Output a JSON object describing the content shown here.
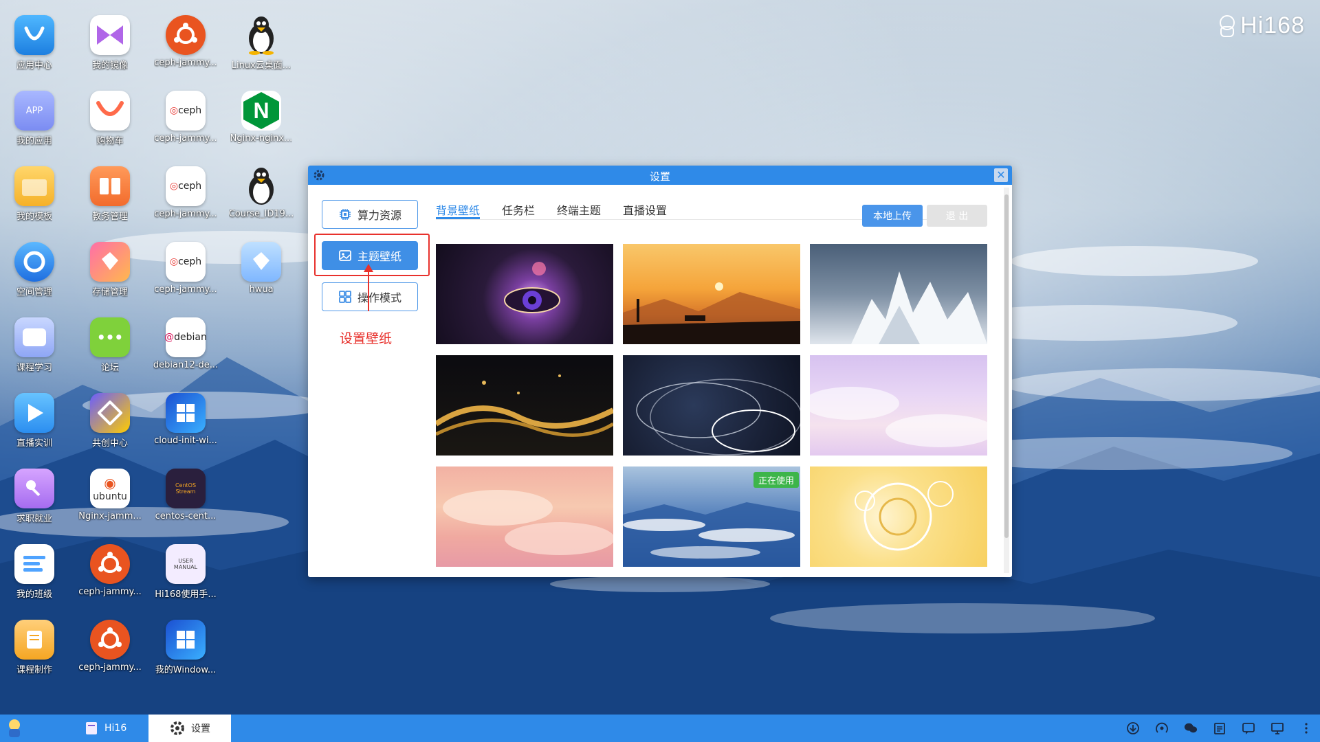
{
  "brand": "Hi168",
  "desktop_icons": [
    {
      "label": "应用中心"
    },
    {
      "label": "我的镜像"
    },
    {
      "label": "ceph-jammy..."
    },
    {
      "label": "Linux云桌面..."
    },
    {
      "label": "我的应用",
      "icon_text": "APP"
    },
    {
      "label": "购物车"
    },
    {
      "label": "ceph-jammy...",
      "icon_text": "ceph"
    },
    {
      "label": "Nginx-nginx...",
      "icon_text": "N"
    },
    {
      "label": "我的模板"
    },
    {
      "label": "教务管理"
    },
    {
      "label": "ceph-jammy...",
      "icon_text": "ceph"
    },
    {
      "label": "Course_ID19..."
    },
    {
      "label": "空间管理"
    },
    {
      "label": "存储管理"
    },
    {
      "label": "ceph-jammy...",
      "icon_text": "ceph"
    },
    {
      "label": "hwua"
    },
    {
      "label": "课程学习"
    },
    {
      "label": "论坛",
      "icon_text": "•••"
    },
    {
      "label": "debian12-de...",
      "icon_text": "debian"
    },
    {
      "label": "直播实训"
    },
    {
      "label": "共创中心"
    },
    {
      "label": "cloud-init-wi..."
    },
    {
      "label": "求职就业"
    },
    {
      "label": "Nginx-jamm...",
      "icon_text": "ubuntu"
    },
    {
      "label": "centos-cent...",
      "icon_text": "CentOS Stream"
    },
    {
      "label": "我的班级"
    },
    {
      "label": "ceph-jammy..."
    },
    {
      "label": "Hi168使用手...",
      "icon_text": "USER MANUAL"
    },
    {
      "label": "课程制作"
    },
    {
      "label": "ceph-jammy..."
    },
    {
      "label": "我的Window..."
    }
  ],
  "window": {
    "title": "设置",
    "side_buttons": [
      {
        "label": "算力资源",
        "icon": "cpu-icon"
      },
      {
        "label": "主题壁纸",
        "icon": "image-icon",
        "active": true
      },
      {
        "label": "操作模式",
        "icon": "grid-icon"
      }
    ],
    "annotation": "设置壁纸",
    "tabs": [
      {
        "label": "背景壁纸",
        "active": true
      },
      {
        "label": "任务栏"
      },
      {
        "label": "终端主题"
      },
      {
        "label": "直播设置"
      }
    ],
    "upload_label": "本地上传",
    "exit_label": "退 出",
    "wallpapers": [
      {
        "name": "galaxy-eye"
      },
      {
        "name": "desert-sunset"
      },
      {
        "name": "ice-crystals"
      },
      {
        "name": "gold-waves"
      },
      {
        "name": "light-trails"
      },
      {
        "name": "pastel-clouds"
      },
      {
        "name": "pink-clouds"
      },
      {
        "name": "blue-sea-of-clouds",
        "in_use": true,
        "badge": "正在使用"
      },
      {
        "name": "yellow-gears"
      }
    ]
  },
  "taskbar": {
    "items": [
      {
        "label": "Hi16"
      },
      {
        "label": "设置",
        "active": true
      }
    ]
  },
  "colors": {
    "accent": "#2f8ae8",
    "annotation": "#e8312c",
    "badge": "#3db54a"
  }
}
